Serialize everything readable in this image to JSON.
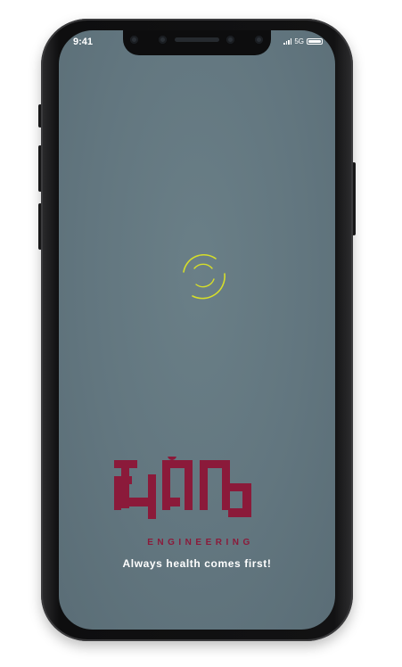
{
  "status_bar": {
    "time": "9:41",
    "network": "5G"
  },
  "splash": {
    "brand_mark": "እብኔ",
    "brand_subtitle": "ENGINEERING",
    "tagline": "Always health comes first!",
    "loading": true
  },
  "colors": {
    "screen_bg": "#62767f",
    "brand": "#8b1a3a",
    "spinner": "#d6de2a",
    "tagline_text": "#ffffff"
  }
}
